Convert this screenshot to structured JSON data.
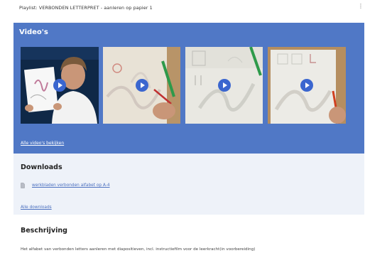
{
  "header": {
    "title": "Playlist: VERBONDEN LETTERPRET - aanleren op papier 1",
    "menu_icon": "kebab-menu-icon"
  },
  "videos": {
    "heading": "Video's",
    "items": [
      {
        "name": "video-1",
        "icon": "play-icon"
      },
      {
        "name": "video-2",
        "icon": "play-icon"
      },
      {
        "name": "video-3",
        "icon": "play-icon"
      },
      {
        "name": "video-4",
        "icon": "play-icon"
      }
    ],
    "all_link": "Alle video's bekijken",
    "accent_color": "#5078c6"
  },
  "downloads": {
    "heading": "Downloads",
    "files": [
      {
        "label": "werkbladen verbonden alfabet op A-4",
        "icon": "file-icon"
      }
    ],
    "all_link": "Alle downloads"
  },
  "description": {
    "heading": "Beschrijving",
    "text": "Het alfabet van verbonden letters aanleren met diapositieven, incl. instructiefilm voor de leerkracht(in voorbereiding)"
  }
}
